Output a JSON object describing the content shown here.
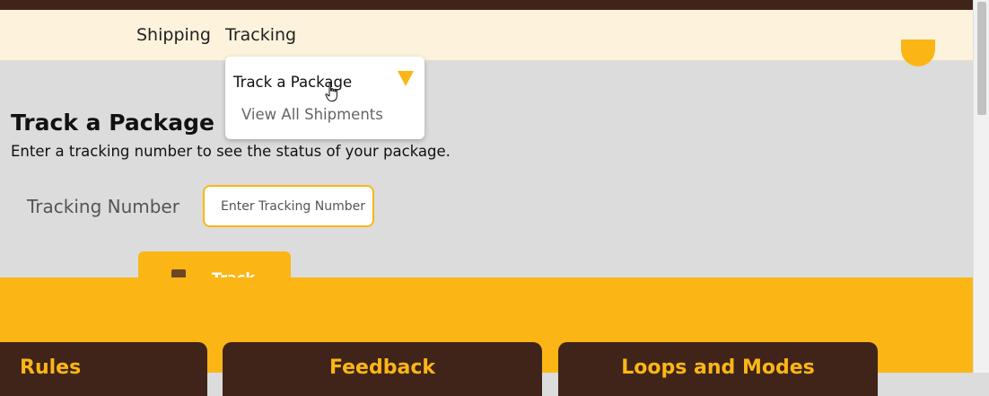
{
  "nav": {
    "items": [
      {
        "label": "Shipping"
      },
      {
        "label": "Tracking"
      }
    ]
  },
  "dropdown": {
    "items": [
      {
        "label": "Track a Package"
      },
      {
        "label": "View All Shipments"
      }
    ]
  },
  "main": {
    "title": "Track a Package",
    "subtitle": "Enter a tracking number to see the status of your package.",
    "tracking_label": "Tracking Number",
    "tracking_input": {
      "value": "",
      "placeholder": "Enter Tracking Number"
    },
    "track_button_label": "Track"
  },
  "cards": [
    {
      "title": "Rules"
    },
    {
      "title": "Feedback"
    },
    {
      "title": "Loops and Modes"
    }
  ],
  "icons": {
    "dropdown_arrow": "triangle-down-icon",
    "track_button_icon": "package-icon",
    "cursor": "hand-pointer-icon"
  },
  "colors": {
    "accent": "#fbb616",
    "dark_brown": "#40241a",
    "nav_background": "#fdf3dc",
    "page_background": "#dcdcdc"
  }
}
